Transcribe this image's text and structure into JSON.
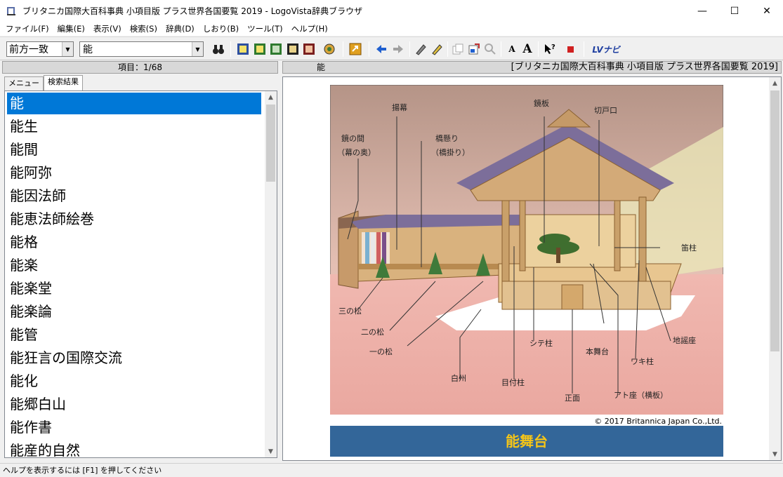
{
  "window": {
    "title": "ブリタニカ国際大百科事典 小項目版 プラス世界各国要覧 2019 - LogoVista辞典ブラウザ",
    "minimize": "—",
    "maximize": "☐",
    "close": "✕"
  },
  "menu": [
    "ファイル(F)",
    "編集(E)",
    "表示(V)",
    "検索(S)",
    "辞典(D)",
    "しおり(B)",
    "ツール(T)",
    "ヘルプ(H)"
  ],
  "toolbar": {
    "match_mode": "前方一致",
    "search_value": "能",
    "font_small": "A",
    "font_large": "A",
    "lv_navi": "LVナビ"
  },
  "left": {
    "header": "項目：1/68",
    "tabs": [
      "メニュー",
      "検索結果"
    ],
    "active_tab": "検索結果",
    "items": [
      "能",
      "能生",
      "能間",
      "能阿弥",
      "能因法師",
      "能恵法師絵巻",
      "能格",
      "能楽",
      "能楽堂",
      "能楽論",
      "能管",
      "能狂言の国際交流",
      "能化",
      "能郷白山",
      "能作書",
      "能産的自然"
    ]
  },
  "right": {
    "headword": "能",
    "dictionary": "[ブリタニカ国際大百科事典 小項目版 プラス世界各国要覧 2019]",
    "figure_labels": {
      "agemaku": "揚幕",
      "kagamiita": "鏡板",
      "kiridoguchi": "切戸口",
      "kagami_no_ma": "鏡の間",
      "maku_no_oku": "（幕の奥）",
      "hashigakari": "橋懸り",
      "hashigakari2": "（橋掛り）",
      "fuebashira": "笛柱",
      "sannomatsu": "三の松",
      "ninomatsu": "二の松",
      "ichinomatsu": "一の松",
      "shitebashira": "シテ柱",
      "honbutai": "本舞台",
      "jiutaiza": "地謡座",
      "wakibashira": "ワキ柱",
      "shirasu": "白州",
      "metsukebashira": "目付柱",
      "atoza": "アト座（横板）",
      "shomen": "正面"
    },
    "credit": "© 2017 Britannica Japan Co.,Ltd.",
    "caption": "能舞台"
  },
  "status": "ヘルプを表示するには [F1] を押してください"
}
